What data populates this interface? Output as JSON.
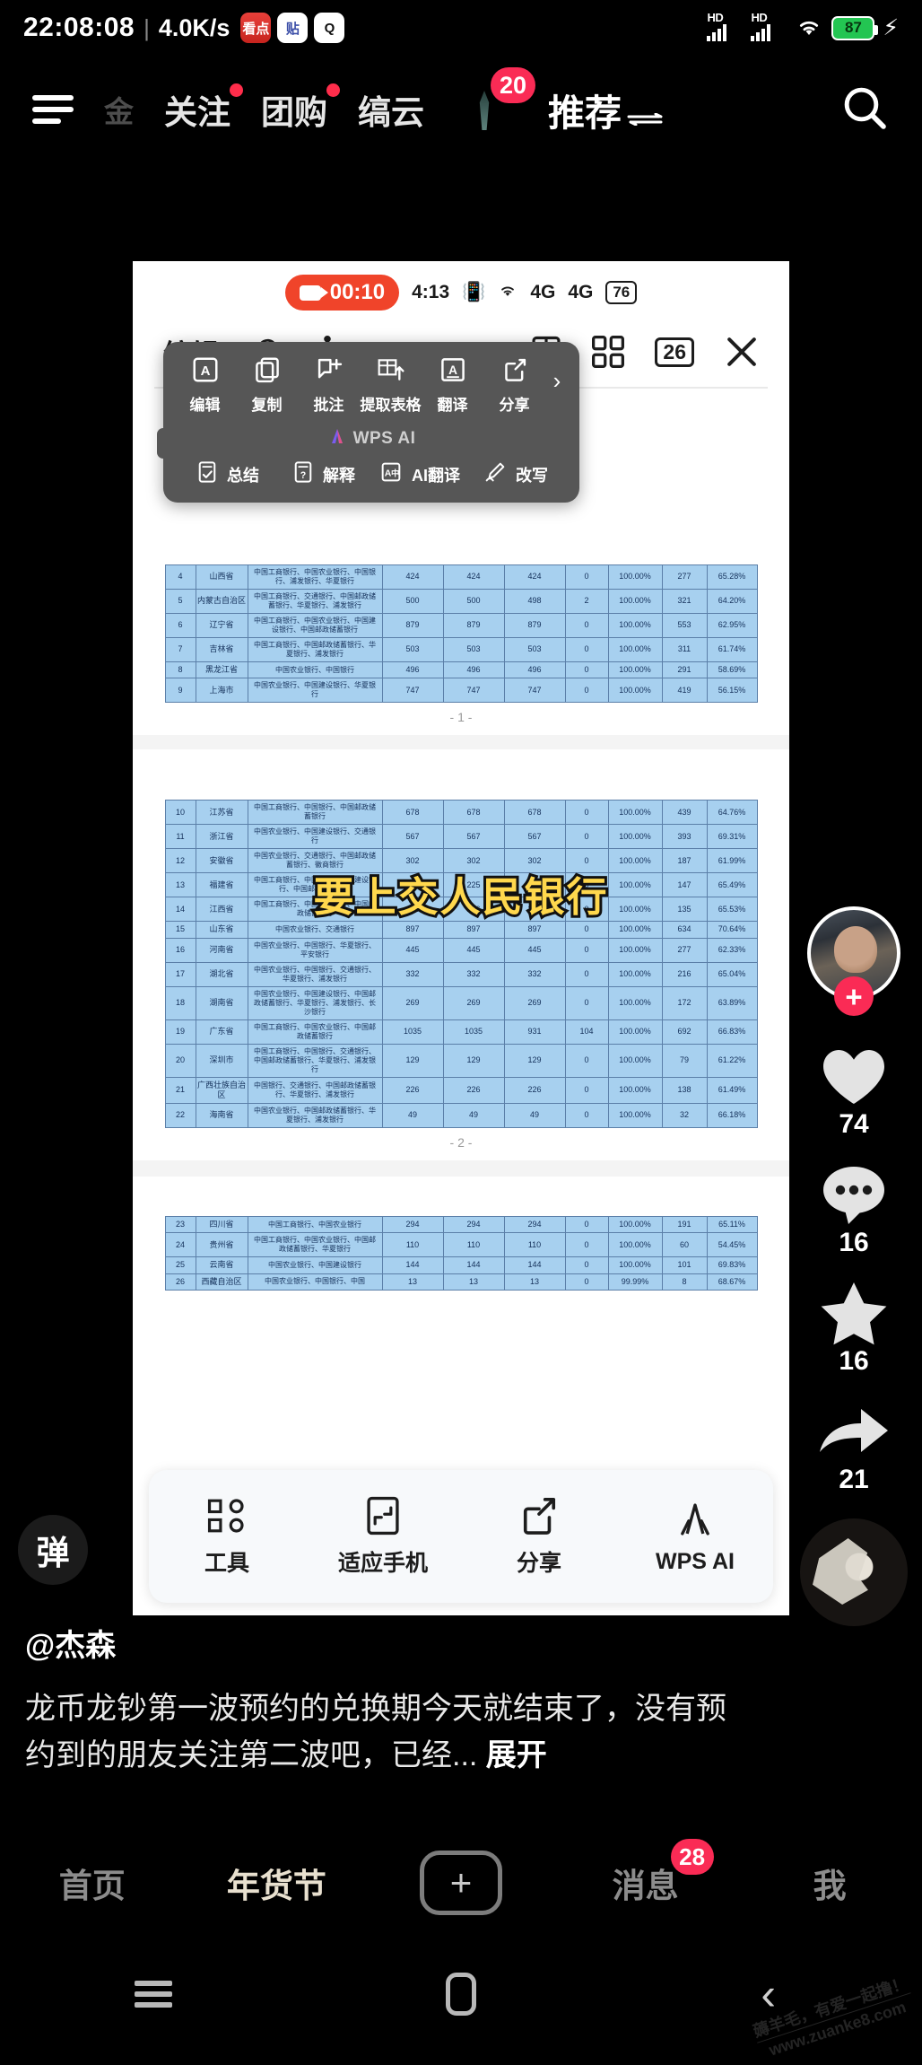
{
  "status_bar": {
    "time": "22:08:08",
    "separator": "|",
    "network_speed": "4.0K/s",
    "app_icons": [
      {
        "name": "kandian-icon",
        "label": "看点"
      },
      {
        "name": "tieba-icon",
        "label": "贴"
      },
      {
        "name": "qq-icon",
        "label": "Q"
      }
    ],
    "signal_1_label": "HD",
    "signal_2_label": "HD",
    "wifi": "wifi-icon",
    "battery_percent": "87",
    "charging": true
  },
  "app_bar": {
    "menu_icon": "hamburger-menu-icon",
    "tabs": [
      {
        "label": "金",
        "dim": true,
        "badge": false
      },
      {
        "label": "关注",
        "dim": false,
        "badge": true
      },
      {
        "label": "团购",
        "dim": false,
        "badge": true
      },
      {
        "label": "缟云",
        "dim": false,
        "badge": false
      }
    ],
    "avatar_badge": "20",
    "active_tab": "推荐",
    "search_icon": "search-icon"
  },
  "video_card": {
    "inner_status": {
      "recording_icon": "record-camera-icon",
      "recording_time": "00:10",
      "clock": "4:13",
      "vibrate_icon": "vibrate-icon",
      "wifi_icon": "wifi-6-icon",
      "sim1": "4G",
      "sim2": "4G",
      "battery": "76"
    },
    "wps_toolbar": {
      "edit_label": "编辑",
      "cloud_upload_icon": "cloud-upload-icon",
      "person_icon": "person-standing-icon",
      "split_view_icon": "split-view-icon",
      "grid_view_icon": "grid-view-icon",
      "page_count": "26",
      "close_icon": "close-icon"
    },
    "ai_menu": {
      "row1": [
        {
          "label": "编辑",
          "icon": "edit-box-icon"
        },
        {
          "label": "复制",
          "icon": "copy-icon"
        },
        {
          "label": "批注",
          "icon": "comment-add-icon"
        },
        {
          "label": "提取表格",
          "icon": "extract-table-icon"
        },
        {
          "label": "翻译",
          "icon": "translate-a-icon"
        },
        {
          "label": "分享",
          "icon": "share-out-icon"
        }
      ],
      "more_icon": "chevron-right-icon",
      "brand": "WPS AI",
      "brand_icon": "wps-ai-logo-icon",
      "row2": [
        {
          "label": "总结",
          "icon": "summary-check-icon"
        },
        {
          "label": "解释",
          "icon": "explain-question-icon"
        },
        {
          "label": "AI翻译",
          "icon": "ai-translate-icon"
        },
        {
          "label": "改写",
          "icon": "rewrite-pen-icon"
        }
      ]
    },
    "overlay_title": "要上交人民银行",
    "bottom_bar": [
      {
        "label": "工具",
        "icon": "tools-grid-icon"
      },
      {
        "label": "适应手机",
        "icon": "fit-to-phone-icon"
      },
      {
        "label": "分享",
        "icon": "share-out-icon"
      },
      {
        "label": "WPS AI",
        "icon": "wps-ai-logo-icon"
      }
    ],
    "pages": [
      {
        "page_label": "- 1 -",
        "rows": [
          [
            "4",
            "山西省",
            "中国工商银行、中国农业银行、中国银行、浦发银行、华夏银行",
            "424",
            "424",
            "424",
            "0",
            "100.00%",
            "277",
            "65.28%"
          ],
          [
            "5",
            "内蒙古自治区",
            "中国工商银行、交通银行、中国邮政储蓄银行、华夏银行、浦发银行",
            "500",
            "500",
            "498",
            "2",
            "100.00%",
            "321",
            "64.20%"
          ],
          [
            "6",
            "辽宁省",
            "中国工商银行、中国农业银行、中国建设银行、中国邮政储蓄银行",
            "879",
            "879",
            "879",
            "0",
            "100.00%",
            "553",
            "62.95%"
          ],
          [
            "7",
            "吉林省",
            "中国工商银行、中国邮政储蓄银行、华夏银行、浦发银行",
            "503",
            "503",
            "503",
            "0",
            "100.00%",
            "311",
            "61.74%"
          ],
          [
            "8",
            "黑龙江省",
            "中国农业银行、中国银行",
            "496",
            "496",
            "496",
            "0",
            "100.00%",
            "291",
            "58.69%"
          ],
          [
            "9",
            "上海市",
            "中国农业银行、中国建设银行、华夏银行",
            "747",
            "747",
            "747",
            "0",
            "100.00%",
            "419",
            "56.15%"
          ]
        ]
      },
      {
        "page_label": "- 2 -",
        "rows": [
          [
            "10",
            "江苏省",
            "中国工商银行、中国银行、中国邮政储蓄银行",
            "678",
            "678",
            "678",
            "0",
            "100.00%",
            "439",
            "64.76%"
          ],
          [
            "11",
            "浙江省",
            "中国农业银行、中国建设银行、交通银行",
            "567",
            "567",
            "567",
            "0",
            "100.00%",
            "393",
            "69.31%"
          ],
          [
            "12",
            "安徽省",
            "中国农业银行、交通银行、中国邮政储蓄银行、徽商银行",
            "302",
            "302",
            "302",
            "0",
            "100.00%",
            "187",
            "61.99%"
          ],
          [
            "13",
            "福建省",
            "中国工商银行、中国银行、中国建设银行、中国邮政储蓄银行",
            "225",
            "225",
            "225",
            "0",
            "100.00%",
            "147",
            "65.49%"
          ],
          [
            "14",
            "江西省",
            "中国工商银行、中国农业银行、中国邮政储蓄银行",
            "206",
            "206",
            "206",
            "0",
            "100.00%",
            "135",
            "65.53%"
          ],
          [
            "15",
            "山东省",
            "中国农业银行、交通银行",
            "897",
            "897",
            "897",
            "0",
            "100.00%",
            "634",
            "70.64%"
          ],
          [
            "16",
            "河南省",
            "中国农业银行、中国银行、华夏银行、平安银行",
            "445",
            "445",
            "445",
            "0",
            "100.00%",
            "277",
            "62.33%"
          ],
          [
            "17",
            "湖北省",
            "中国农业银行、中国银行、交通银行、华夏银行、浦发银行",
            "332",
            "332",
            "332",
            "0",
            "100.00%",
            "216",
            "65.04%"
          ],
          [
            "18",
            "湖南省",
            "中国农业银行、中国建设银行、中国邮政储蓄银行、华夏银行、浦发银行、长沙银行",
            "269",
            "269",
            "269",
            "0",
            "100.00%",
            "172",
            "63.89%"
          ],
          [
            "19",
            "广东省",
            "中国工商银行、中国农业银行、中国邮政储蓄银行",
            "1035",
            "1035",
            "931",
            "104",
            "100.00%",
            "692",
            "66.83%"
          ],
          [
            "20",
            "深圳市",
            "中国工商银行、中国银行、交通银行、中国邮政储蓄银行、华夏银行、浦发银行",
            "129",
            "129",
            "129",
            "0",
            "100.00%",
            "79",
            "61.22%"
          ],
          [
            "21",
            "广西壮族自治区",
            "中国银行、交通银行、中国邮政储蓄银行、华夏银行、浦发银行",
            "226",
            "226",
            "226",
            "0",
            "100.00%",
            "138",
            "61.49%"
          ],
          [
            "22",
            "海南省",
            "中国农业银行、中国邮政储蓄银行、华夏银行、浦发银行",
            "49",
            "49",
            "49",
            "0",
            "100.00%",
            "32",
            "66.18%"
          ]
        ]
      },
      {
        "page_label": "",
        "rows": [
          [
            "23",
            "四川省",
            "中国工商银行、中国农业银行",
            "294",
            "294",
            "294",
            "0",
            "100.00%",
            "191",
            "65.11%"
          ],
          [
            "24",
            "贵州省",
            "中国工商银行、中国农业银行、中国邮政储蓄银行、华夏银行",
            "110",
            "110",
            "110",
            "0",
            "100.00%",
            "60",
            "54.45%"
          ],
          [
            "25",
            "云南省",
            "中国农业银行、中国建设银行",
            "144",
            "144",
            "144",
            "0",
            "100.00%",
            "101",
            "69.83%"
          ],
          [
            "26",
            "西藏自治区",
            "中国农业银行、中国银行、中国",
            "13",
            "13",
            "13",
            "0",
            "99.99%",
            "8",
            "68.67%"
          ]
        ]
      }
    ]
  },
  "danmu_button": {
    "label": "弹"
  },
  "right_rail": {
    "avatar_name": "author-avatar",
    "follow_plus": "+",
    "like_count": "74",
    "comment_count": "16",
    "star_count": "16",
    "share_count": "21",
    "music_disc": "music-disc-icon"
  },
  "caption": {
    "username": "@杰森",
    "text": "龙币龙钞第一波预约的兑换期今天就结束了，没有预约到的朋友关注第二波吧，已经...",
    "expand_label": "展开"
  },
  "bottom_nav": [
    {
      "label": "首页",
      "active": false,
      "badge": ""
    },
    {
      "label": "年货节",
      "active": true,
      "badge": ""
    },
    {
      "label": "",
      "active": false,
      "badge": "",
      "icon": "add-post-button"
    },
    {
      "label": "消息",
      "active": false,
      "badge": "28"
    },
    {
      "label": "我",
      "active": false,
      "badge": ""
    }
  ],
  "system_nav": {
    "menu_icon": "recent-apps-icon",
    "home_icon": "home-icon",
    "back_icon": "back-icon"
  },
  "watermark": {
    "line1": "薅羊毛，有爱一起撸！",
    "line2": "www.zuanke8.com"
  },
  "colors": {
    "accent_red": "#fa2b55",
    "record_red": "#f0442a",
    "table_fill": "#a7d0ef",
    "table_border": "#5b7fa8",
    "title_yellow": "#ffd84d"
  }
}
